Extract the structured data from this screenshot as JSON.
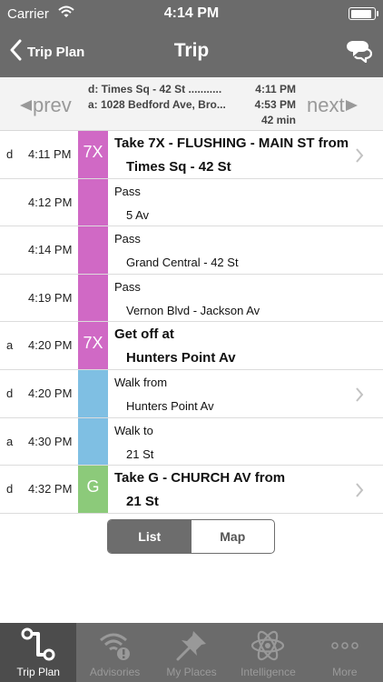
{
  "status_bar": {
    "carrier": "Carrier",
    "time": "4:14 PM",
    "battery_level": 0.9
  },
  "nav": {
    "back_label": "Trip Plan",
    "title": "Trip"
  },
  "summary": {
    "prev_label": "prev",
    "next_label": "next",
    "departure": "d: Times Sq - 42 St ...........",
    "departure_time": "4:11 PM",
    "arrival": "a: 1028 Bedford Ave, Bro...",
    "arrival_time": "4:53 PM",
    "duration": "42 min"
  },
  "colors": {
    "line_7x": "#d069c5",
    "walk": "#7fbfe3",
    "line_g": "#8cca7a",
    "bar": "#6b6b6b"
  },
  "rows": [
    {
      "da": "d",
      "time": "4:11 PM",
      "badge": "7X",
      "line1": "Take 7X - FLUSHING - MAIN ST from",
      "line2": "Times Sq - 42 St"
    },
    {
      "da": "",
      "time": "4:12 PM",
      "badge": "",
      "line1": "Pass",
      "line2": "5 Av"
    },
    {
      "da": "",
      "time": "4:14 PM",
      "badge": "",
      "line1": "Pass",
      "line2": "Grand Central - 42 St"
    },
    {
      "da": "",
      "time": "4:19 PM",
      "badge": "",
      "line1": "Pass",
      "line2": "Vernon Blvd - Jackson Av"
    },
    {
      "da": "a",
      "time": "4:20 PM",
      "badge": "7X",
      "line1": "Get off at",
      "line2": "Hunters Point Av"
    },
    {
      "da": "d",
      "time": "4:20 PM",
      "badge": "",
      "line1": "Walk from",
      "line2": "Hunters Point Av"
    },
    {
      "da": "a",
      "time": "4:30 PM",
      "badge": "",
      "line1": "Walk to",
      "line2": "21 St"
    },
    {
      "da": "d",
      "time": "4:32 PM",
      "badge": "G",
      "line1": "Take G - CHURCH AV from",
      "line2": "21 St"
    }
  ],
  "view_toggle": {
    "list_label": "List",
    "map_label": "Map",
    "selected": "List"
  },
  "tabs": [
    {
      "label": "Trip Plan",
      "icon": "route-icon"
    },
    {
      "label": "Advisories",
      "icon": "signal-alert-icon"
    },
    {
      "label": "My Places",
      "icon": "pushpin-icon"
    },
    {
      "label": "Intelligence",
      "icon": "atom-icon"
    },
    {
      "label": "More",
      "icon": "ellipsis-icon"
    }
  ]
}
